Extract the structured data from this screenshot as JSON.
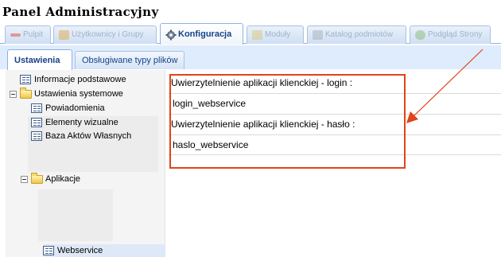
{
  "app": {
    "title": "Panel Administracyjny"
  },
  "main_tabs": [
    {
      "label": "Pulpit",
      "icon": "minus-icon",
      "active": false
    },
    {
      "label": "Użytkownicy i Grupy",
      "icon": "users-icon",
      "active": false
    },
    {
      "label": "Konfiguracja",
      "icon": "gear-icon",
      "active": true
    },
    {
      "label": "Moduły",
      "icon": "puzzle-icon",
      "active": false
    },
    {
      "label": "Katalog podmiotów",
      "icon": "catalog-icon",
      "active": false
    },
    {
      "label": "Podgląd Strony",
      "icon": "globe-icon",
      "active": false
    }
  ],
  "sub_tabs": [
    {
      "label": "Ustawienia",
      "active": true
    },
    {
      "label": "Obsługiwane typy plików",
      "active": false
    }
  ],
  "tree": {
    "items": [
      {
        "label": "Informacje podstawowe",
        "type": "page"
      },
      {
        "label": "Ustawienia systemowe",
        "type": "folder",
        "expanded": true
      },
      {
        "label": "Powiadomienia",
        "type": "page"
      },
      {
        "label": "Elementy wizualne",
        "type": "page"
      },
      {
        "label": "Baza Aktów Własnych",
        "type": "page"
      },
      {
        "label": "Aplikacje",
        "type": "folder",
        "expanded": true
      },
      {
        "label": "Webservice",
        "type": "page",
        "selected": true
      }
    ]
  },
  "form": {
    "login_label": "Uwierzytelnienie aplikacji klienckiej - login :",
    "login_value": "login_webservice",
    "password_label": "Uwierzytelnienie aplikacji klienckiej - hasło :",
    "password_value": "haslo_webservice"
  },
  "colors": {
    "annotation": "#e0441a",
    "tab_text": "#15428b",
    "subtab_bar": "#deecfd"
  }
}
